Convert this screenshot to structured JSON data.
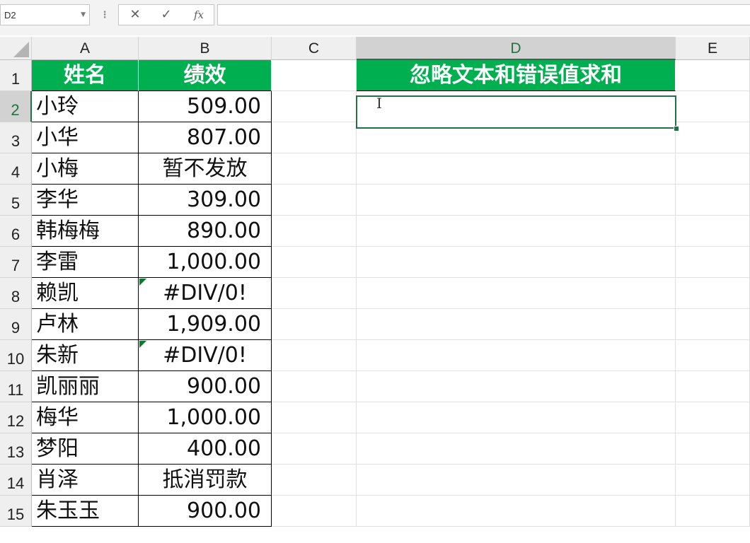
{
  "formula_bar": {
    "name_box": "D2",
    "cancel_glyph": "✕",
    "enter_glyph": "✓",
    "fx_label": "fx",
    "formula_value": ""
  },
  "columns": [
    "A",
    "B",
    "C",
    "D",
    "E"
  ],
  "selected_column": "D",
  "selected_row": "2",
  "rows": [
    "1",
    "2",
    "3",
    "4",
    "5",
    "6",
    "7",
    "8",
    "9",
    "10",
    "11",
    "12",
    "13",
    "14",
    "15"
  ],
  "table": {
    "header_name": "姓名",
    "header_value": "绩效",
    "records": [
      {
        "name": "小玲",
        "value": "509.00"
      },
      {
        "name": "小华",
        "value": "807.00"
      },
      {
        "name": "小梅",
        "value": "暂不发放"
      },
      {
        "name": "李华",
        "value": "309.00"
      },
      {
        "name": "韩梅梅",
        "value": "890.00"
      },
      {
        "name": "李雷",
        "value": "1,000.00"
      },
      {
        "name": "赖凯",
        "value": "#DIV/0!"
      },
      {
        "name": "卢林",
        "value": "1,909.00"
      },
      {
        "name": "朱新",
        "value": "#DIV/0!"
      },
      {
        "name": "凯丽丽",
        "value": "900.00"
      },
      {
        "name": "梅华",
        "value": "1,000.00"
      },
      {
        "name": "梦阳",
        "value": "400.00"
      },
      {
        "name": "肖泽",
        "value": "抵消罚款"
      },
      {
        "name": "朱玉玉",
        "value": "900.00"
      }
    ]
  },
  "result": {
    "header": "忽略文本和错误值求和",
    "value": ""
  },
  "colors": {
    "header_fill": "#00b050",
    "selection": "#217346",
    "error_indicator": "#0d7a32"
  }
}
